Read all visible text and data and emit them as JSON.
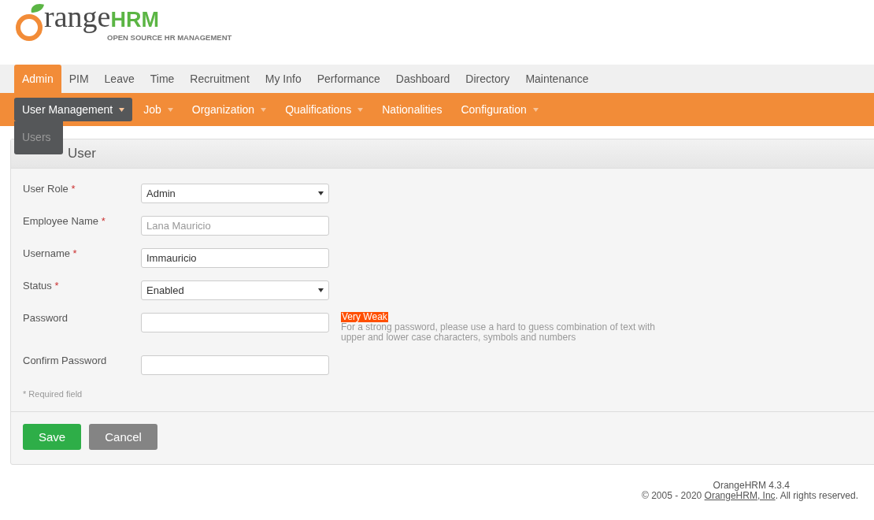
{
  "logo": {
    "word": "range",
    "brand": "HRM",
    "tagline": "OPEN SOURCE HR MANAGEMENT"
  },
  "main_menu": [
    {
      "label": "Admin",
      "selected": true
    },
    {
      "label": "PIM",
      "selected": false
    },
    {
      "label": "Leave",
      "selected": false
    },
    {
      "label": "Time",
      "selected": false
    },
    {
      "label": "Recruitment",
      "selected": false
    },
    {
      "label": "My Info",
      "selected": false
    },
    {
      "label": "Performance",
      "selected": false
    },
    {
      "label": "Dashboard",
      "selected": false
    },
    {
      "label": "Directory",
      "selected": false
    },
    {
      "label": "Maintenance",
      "selected": false
    }
  ],
  "sub_menu": [
    {
      "label": "User Management",
      "selected": true,
      "dropdown": true
    },
    {
      "label": "Job",
      "selected": false,
      "dropdown": true
    },
    {
      "label": "Organization",
      "selected": false,
      "dropdown": true
    },
    {
      "label": "Qualifications",
      "selected": false,
      "dropdown": true
    },
    {
      "label": "Nationalities",
      "selected": false,
      "dropdown": false
    },
    {
      "label": "Configuration",
      "selected": false,
      "dropdown": true
    }
  ],
  "open_dropdown": {
    "items": [
      "Users"
    ]
  },
  "panel": {
    "title": "User"
  },
  "fields": [
    {
      "kind": "select",
      "label": "User Role",
      "required_mark": "*",
      "value": "Admin"
    },
    {
      "kind": "input",
      "label": "Employee Name",
      "required_mark": "*",
      "placeholder": "Lana Mauricio"
    },
    {
      "kind": "input",
      "label": "Username",
      "required_mark": "*",
      "value": "Immauricio"
    },
    {
      "kind": "select",
      "label": "Status",
      "required_mark": "*",
      "value": "Enabled"
    },
    {
      "kind": "password",
      "label": "Password",
      "strength": "Very Weak",
      "hint": "For a strong password, please use a hard to guess combination of text with upper and lower case characters, symbols and numbers"
    },
    {
      "kind": "input",
      "label": "Confirm Password"
    }
  ],
  "required_note": "* Required field",
  "buttons": [
    {
      "label": "Save",
      "kind": "primary"
    },
    {
      "label": "Cancel",
      "kind": "secondary"
    }
  ],
  "footer": {
    "version": "OrangeHRM 4.3.4",
    "copyright_before": "© 2005 - 2020 ",
    "link": "OrangeHRM, Inc",
    "copyright_after": ". All rights reserved."
  }
}
